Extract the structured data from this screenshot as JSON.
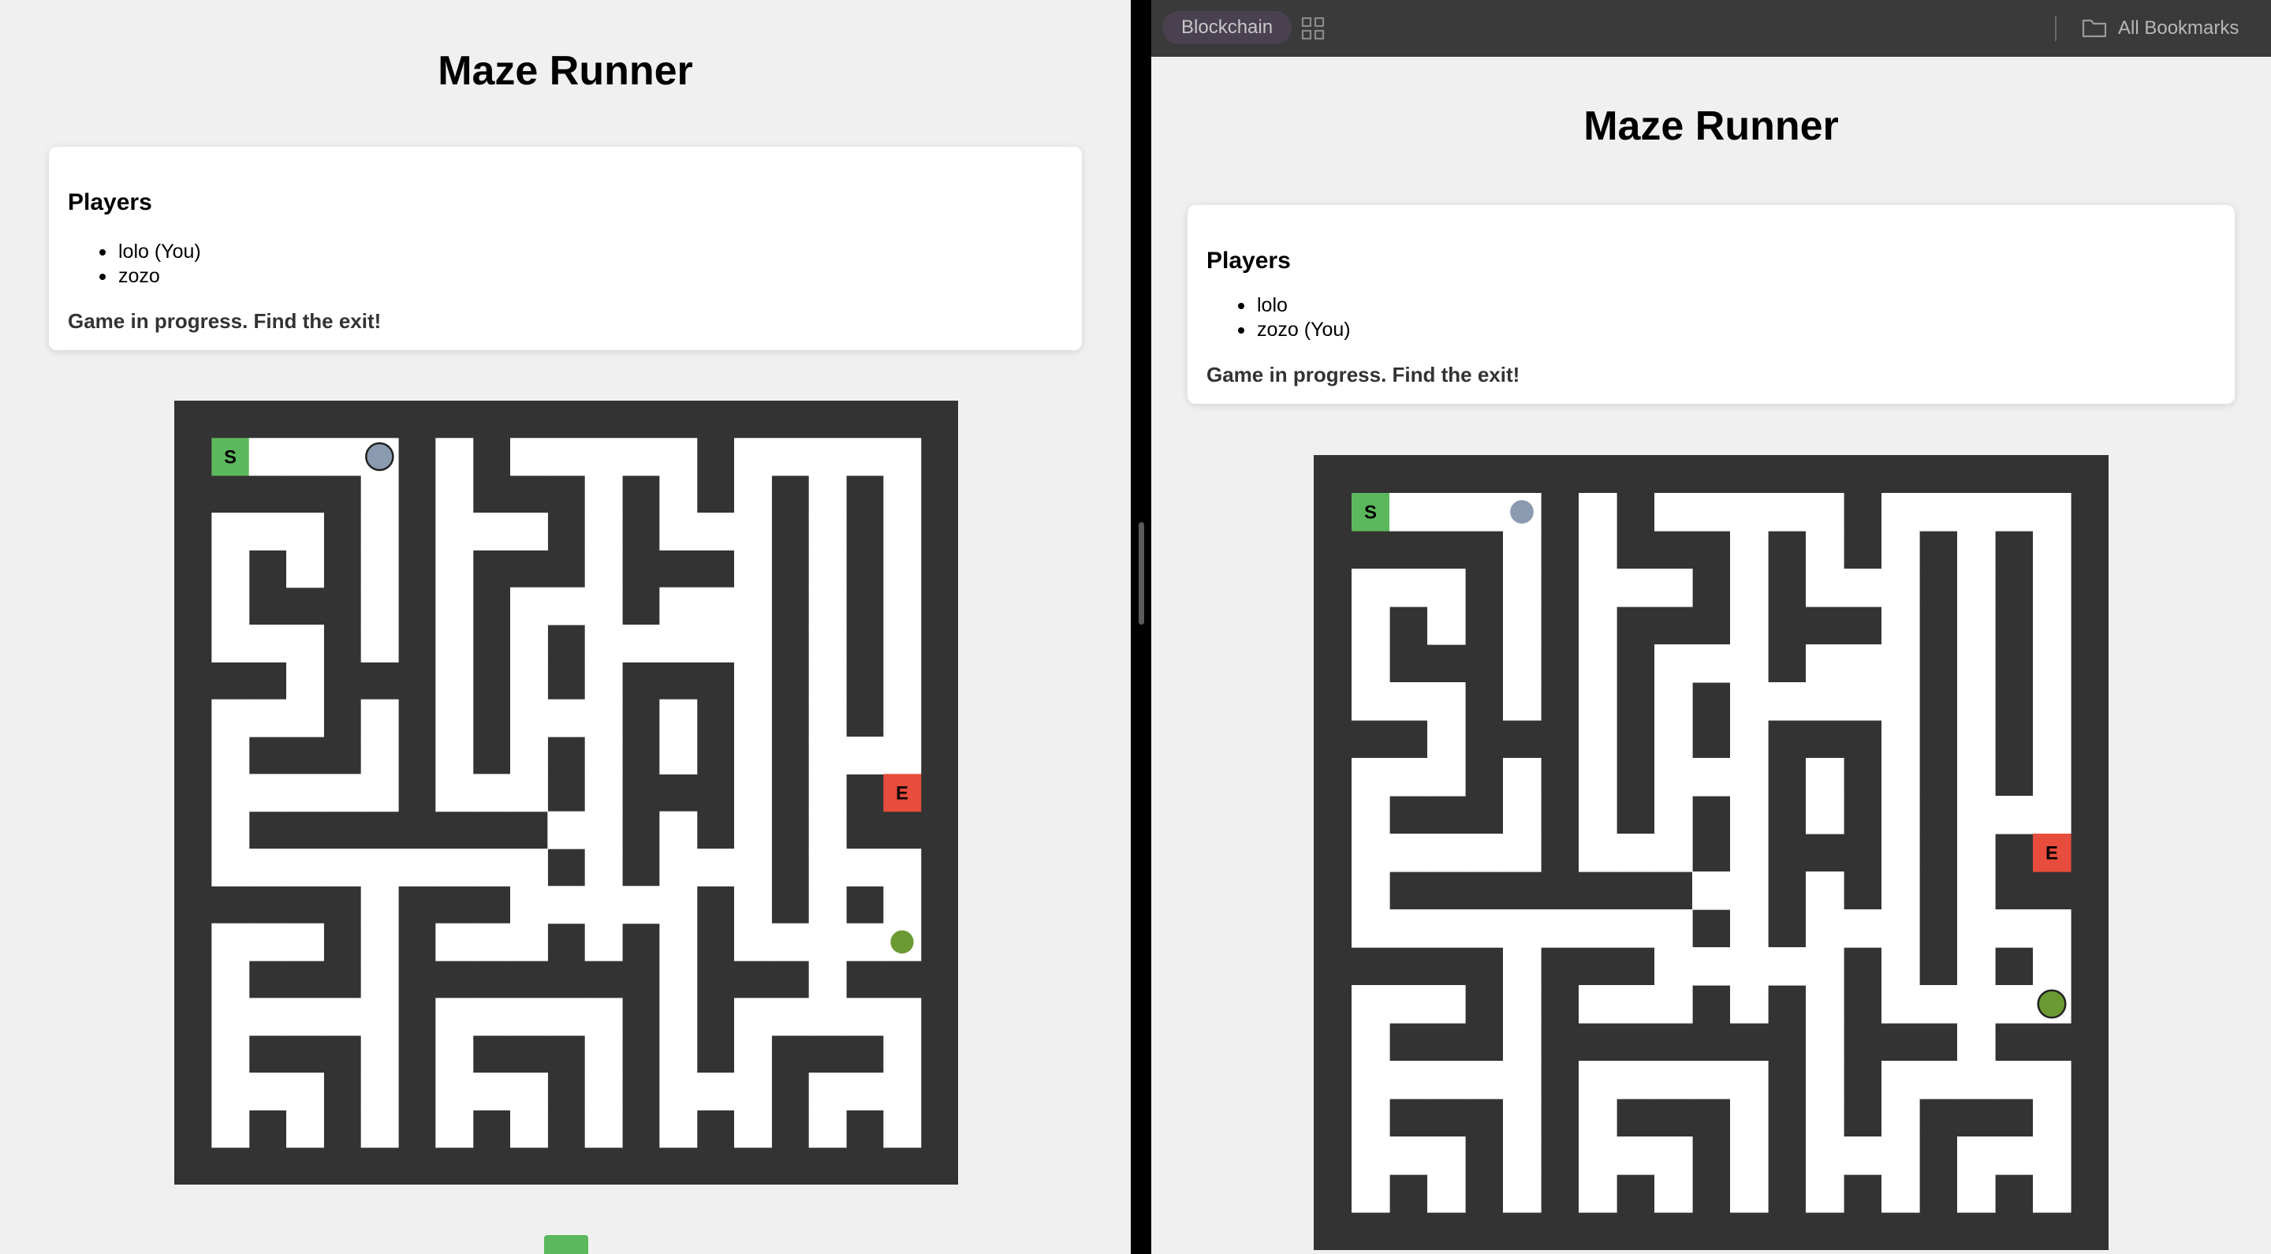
{
  "left": {
    "title": "Maze Runner",
    "players_heading": "Players",
    "players": [
      "lolo (You)",
      "zozo"
    ],
    "status": "Game in progress. Find the exit!"
  },
  "right": {
    "title": "Maze Runner",
    "players_heading": "Players",
    "players": [
      "lolo",
      "zozo (You)"
    ],
    "status": "Game in progress. Find the exit!"
  },
  "toolbar": {
    "bookmark_chip": "Blockchain",
    "apps_icon": "grid-icon",
    "all_bookmarks": "All Bookmarks",
    "folder_icon": "folder-icon"
  },
  "maze": {
    "grid_size": 21,
    "rows": [
      "#####################",
      "#S....#.#.....#.....#",
      "#####.#.###.#.#.#.#.#",
      "#...#.#...#.#...#.#.#",
      "#.#.#.#.###.###.#.#.#",
      "#.###.#.#...#...#.#.#",
      "#...#.#.#.#.....#.#.#",
      "###.###.#.#.###.#.#.#",
      "#...#.#.#...#.#.#.#.#",
      "#.###.#.#.#.#.#.#...#",
      "#.....#...#.###.#.#E#",
      "#.########..#.#.#.###",
      "#.........#.#...#...#",
      "#####.###.....#.#.#.#",
      "#...#.#...#.#.#.....#",
      "#.###.#######.###.###",
      "#.....#.....#.#.....#",
      "#.###.#.###.#.#.###.#",
      "#...#.#...#.#...#...#",
      "#.#.#.#.#.#.#.#.#.#.#",
      "#####################"
    ],
    "labels": {
      "start": "S",
      "end": "E"
    },
    "colors": {
      "wall": "#333333",
      "path": "#ffffff",
      "start": "#5cb85c",
      "end": "#e74c3c",
      "player_lolo": "#8a9bb0",
      "player_zozo": "#6b9a33"
    },
    "player_cells": {
      "lolo": {
        "row": 1,
        "col": 5
      },
      "zozo": {
        "row": 14,
        "col": 19
      }
    }
  }
}
